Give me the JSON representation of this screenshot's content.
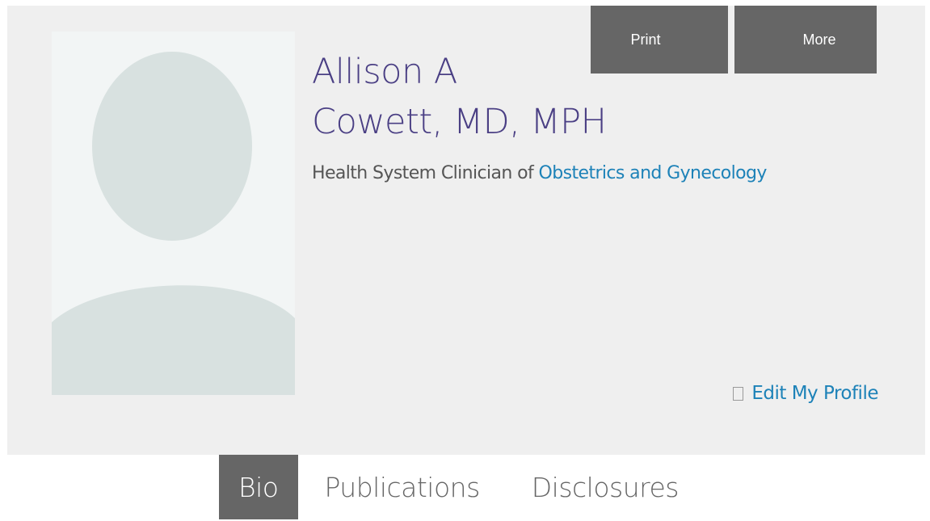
{
  "profile": {
    "name_line1": "Allison A",
    "name_line2": "Cowett, MD, MPH",
    "title_prefix": "Health System Clinician of ",
    "department": "Obstetrics and Gynecology"
  },
  "actions": {
    "print_label": "Print",
    "more_label": "More",
    "edit_profile_label": "Edit My Profile"
  },
  "tabs": [
    {
      "label": "Bio",
      "active": true
    },
    {
      "label": "Publications",
      "active": false
    },
    {
      "label": "Disclosures",
      "active": false
    }
  ],
  "colors": {
    "panel_bg": "#efefef",
    "name_color": "#4a3f84",
    "link_color": "#1d82b8",
    "button_bg": "#666666"
  },
  "icons": {
    "edit_icon": "edit-icon",
    "avatar": "placeholder-person-silhouette"
  }
}
